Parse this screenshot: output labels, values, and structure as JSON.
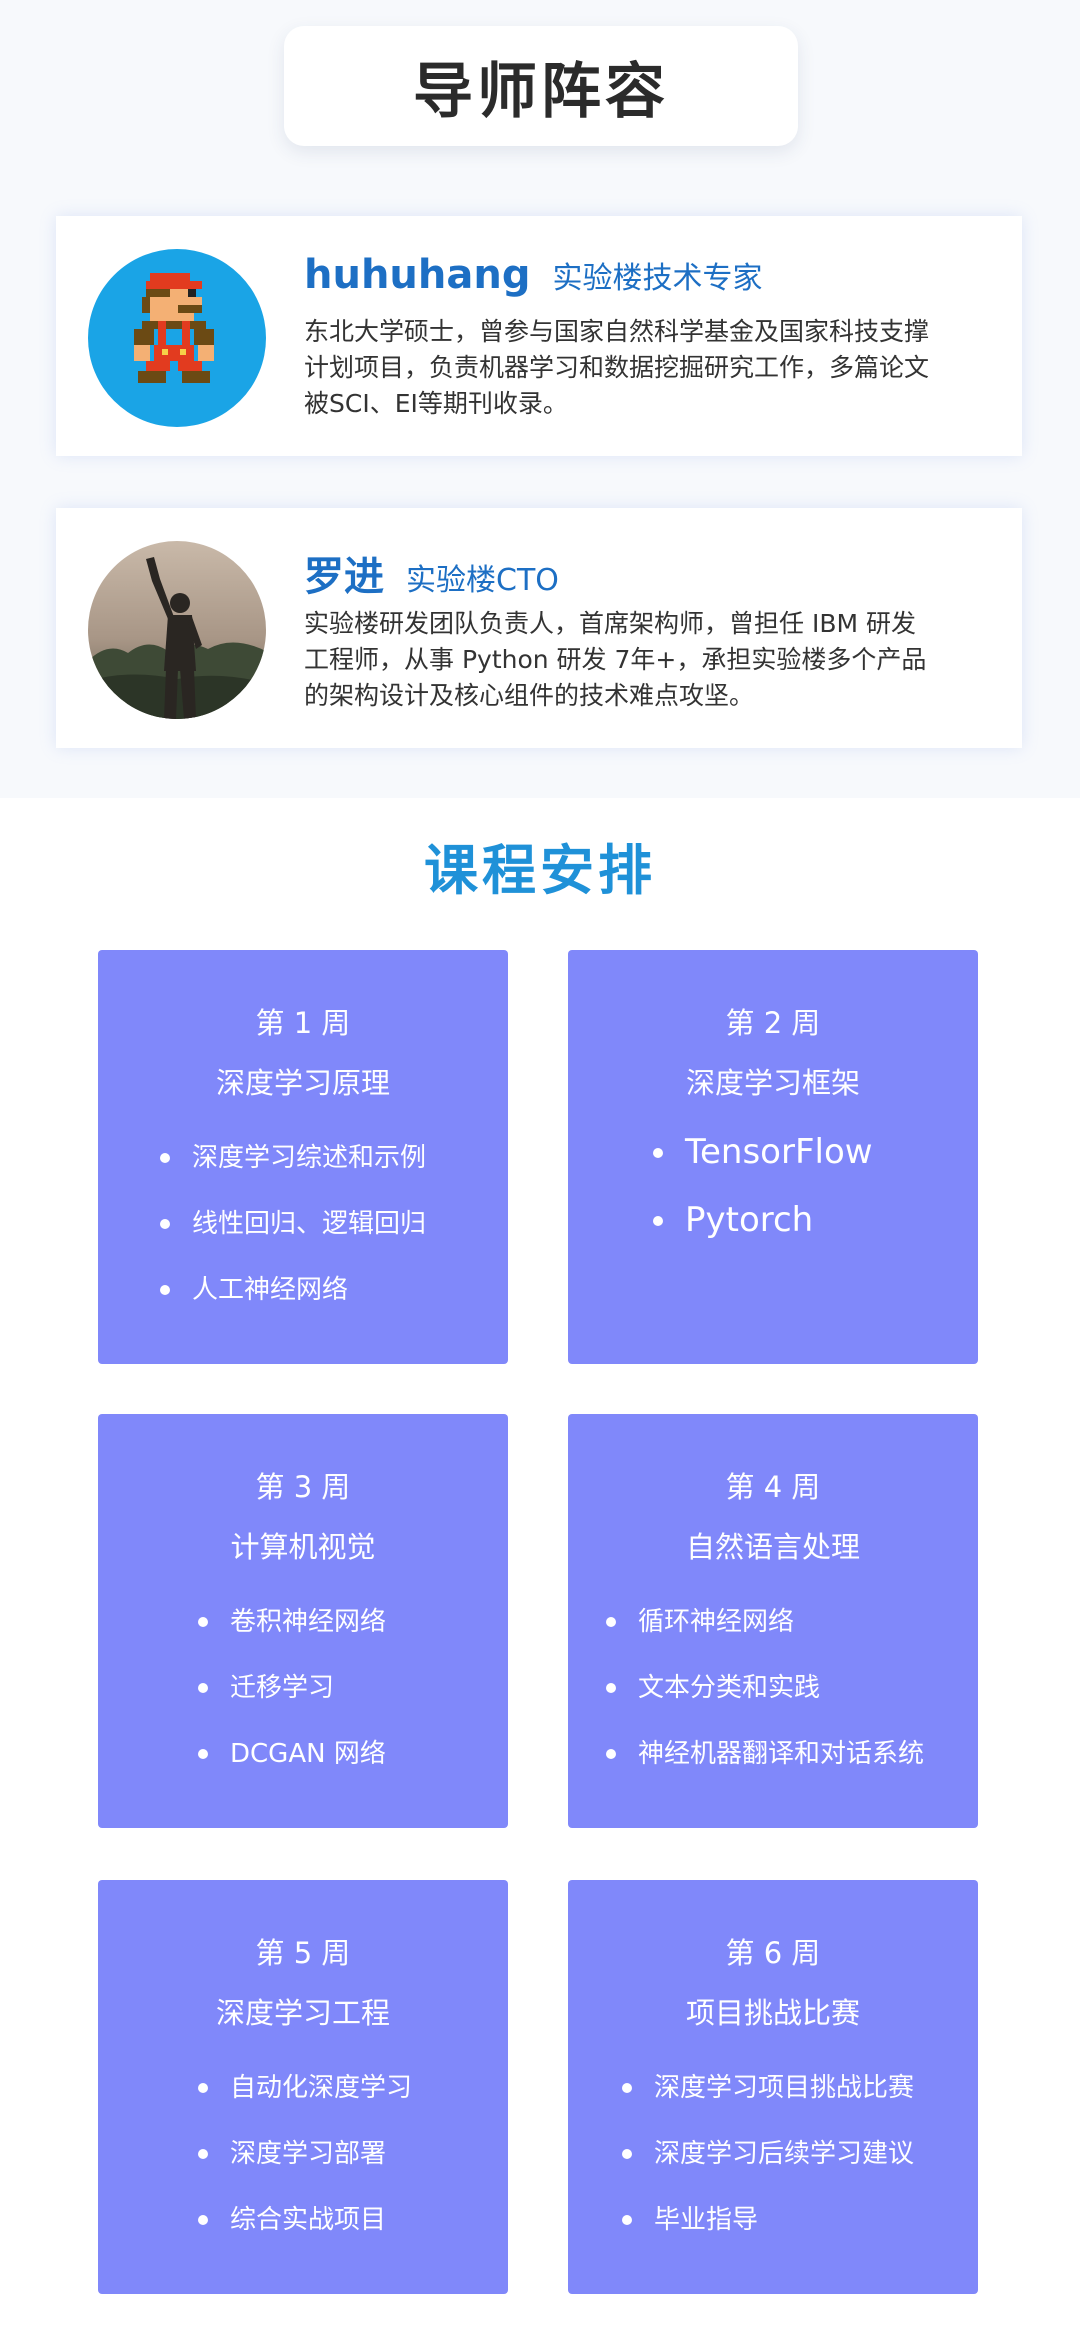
{
  "header": {
    "title": "导师阵容"
  },
  "mentors": [
    {
      "name": "huhuhang",
      "role": "实验楼技术专家",
      "desc": [
        "东北大学硕士，曾参与国家自然科学基金及国家科技支撑",
        "计划项目，负责机器学习和数据挖掘研究工作，多篇论文",
        "被SCI、EI等期刊收录。"
      ],
      "avatar_bg": "#1aa4e6"
    },
    {
      "name": "罗进",
      "role": "实验楼CTO",
      "desc": [
        "实验楼研发团队负责人，首席架构师，曾担任 IBM 研发",
        "工程师，从事 Python 研发 7年+，承担实验楼多个产品",
        "的架构设计及核心组件的技术难点攻坚。"
      ]
    }
  ],
  "schedule": {
    "title": "课程安排",
    "card_color": "#8088fa",
    "weeks": [
      {
        "week": "第 1 周",
        "topic": "深度学习原理",
        "items": [
          "深度学习综述和示例",
          "线性回归、逻辑回归",
          "人工神经网络"
        ]
      },
      {
        "week": "第 2 周",
        "topic": "深度学习框架",
        "items": [
          "TensorFlow",
          "Pytorch"
        ]
      },
      {
        "week": "第 3 周",
        "topic": "计算机视觉",
        "items": [
          "卷积神经网络",
          "迁移学习",
          "DCGAN 网络"
        ]
      },
      {
        "week": "第 4 周",
        "topic": "自然语言处理",
        "items": [
          "循环神经网络",
          "文本分类和实践",
          "神经机器翻译和对话系统"
        ]
      },
      {
        "week": "第 5 周",
        "topic": "深度学习工程",
        "items": [
          "自动化深度学习",
          "深度学习部署",
          "综合实战项目"
        ]
      },
      {
        "week": "第 6 周",
        "topic": "项目挑战比赛",
        "items": [
          "深度学习项目挑战比赛",
          "深度学习后续学习建议",
          "毕业指导"
        ]
      }
    ]
  }
}
